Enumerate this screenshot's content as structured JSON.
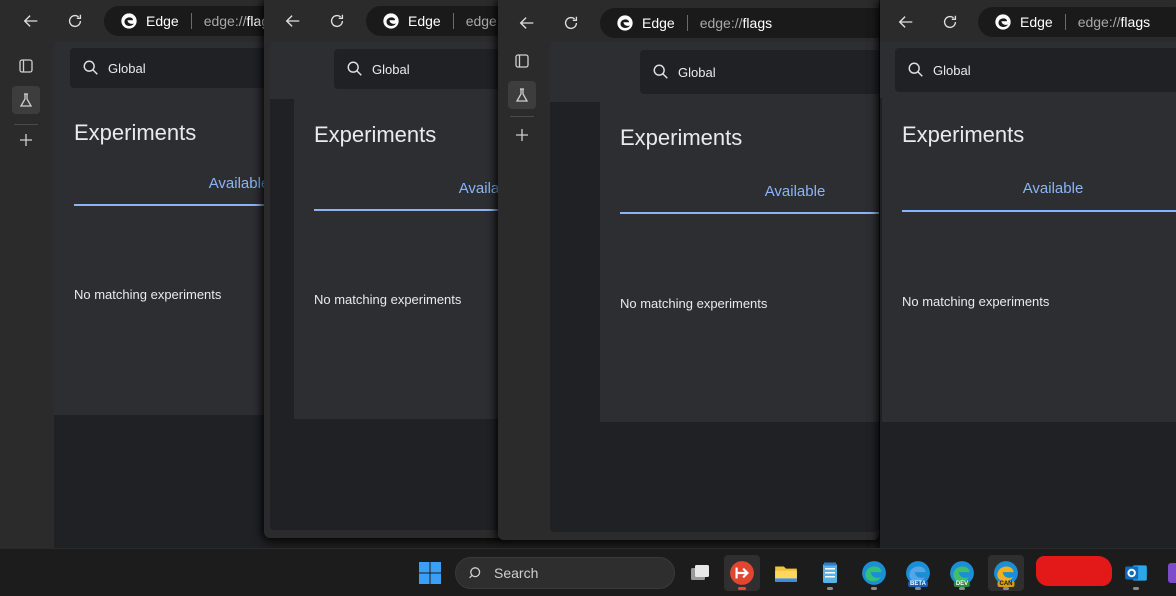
{
  "browser": {
    "site_label": "Edge",
    "url_scheme": "edge://",
    "url_path": "flags"
  },
  "flags_page": {
    "search_value": "Global",
    "heading": "Experiments",
    "tab_available": "Available",
    "empty_message": "No matching experiments"
  },
  "taskbar": {
    "search_label": "Search",
    "badges": {
      "beta": "BETA",
      "dev": "DEV",
      "can": "CAN"
    }
  },
  "colors": {
    "accent": "#8ab4f8",
    "redaction": "#e31919"
  },
  "icons": [
    "back-arrow-icon",
    "refresh-icon",
    "edge-logo-icon",
    "search-icon",
    "tab-actions-icon",
    "flask-icon",
    "plus-icon",
    "windows-start-icon",
    "task-view-icon",
    "remote-desktop-icon",
    "file-explorer-icon",
    "notepad-icon",
    "edge-icon",
    "edge-beta-icon",
    "edge-dev-icon",
    "edge-canary-icon",
    "outlook-icon"
  ]
}
